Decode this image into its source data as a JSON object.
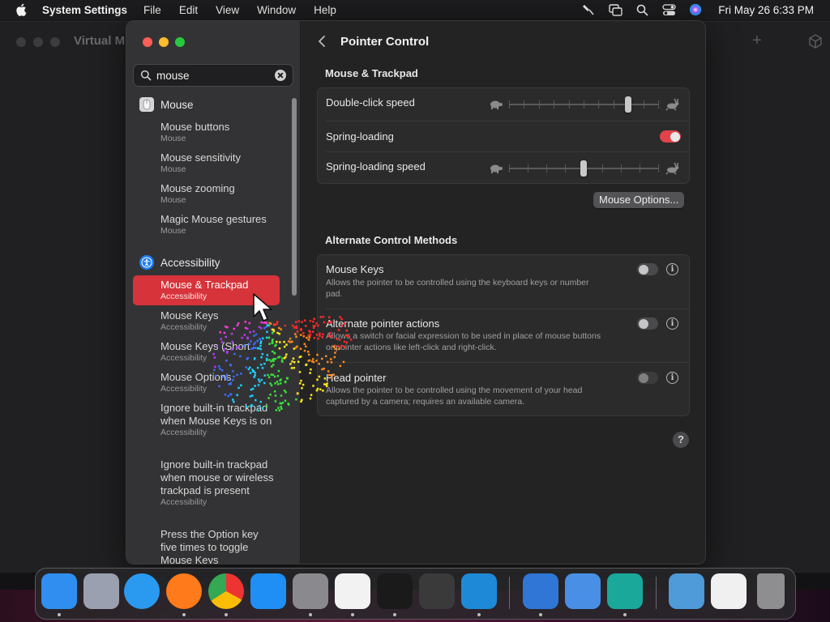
{
  "menubar": {
    "app_name": "System Settings",
    "menus": [
      "File",
      "Edit",
      "View",
      "Window",
      "Help"
    ],
    "clock": "Fri May 26  6:33 PM"
  },
  "background_window": {
    "title": "Virtual M"
  },
  "sidebar": {
    "search": {
      "value": "mouse"
    },
    "categories": [
      {
        "label": "Mouse",
        "icon": "mouse-icon"
      },
      {
        "label": "Accessibility",
        "icon": "accessibility-icon",
        "color": "#1e7cf2"
      }
    ],
    "results": [
      {
        "title": "Mouse buttons",
        "subtitle": "Mouse"
      },
      {
        "title": "Mouse sensitivity",
        "subtitle": "Mouse"
      },
      {
        "title": "Mouse zooming",
        "subtitle": "Mouse"
      },
      {
        "title": "Magic Mouse gestures",
        "subtitle": "Mouse"
      },
      {
        "title": "Mouse & Trackpad",
        "subtitle": "Accessibility",
        "selected": true
      },
      {
        "title": "Mouse Keys",
        "subtitle": "Accessibility"
      },
      {
        "title": "Mouse Keys (Short",
        "subtitle": "Accessibility"
      },
      {
        "title": "Mouse Options",
        "subtitle": "Accessibility"
      },
      {
        "title": "Ignore built-in trackpad when Mouse Keys is on",
        "subtitle": "Accessibility"
      },
      {
        "title": "Ignore built-in trackpad when mouse or wireless trackpad is present",
        "subtitle": "Accessibility"
      },
      {
        "title": "Press the Option key five times to toggle Mouse Keys",
        "subtitle": ""
      }
    ]
  },
  "main": {
    "title": "Pointer Control",
    "mouse_trackpad": {
      "heading": "Mouse & Trackpad",
      "double_click_speed": {
        "label": "Double-click speed",
        "value": 0.8
      },
      "spring_loading": {
        "label": "Spring-loading",
        "on": true
      },
      "spring_loading_speed": {
        "label": "Spring-loading speed",
        "value": 0.5
      },
      "mouse_options_button": "Mouse Options..."
    },
    "alternate": {
      "heading": "Alternate Control Methods",
      "items": [
        {
          "label": "Mouse Keys",
          "description": "Allows the pointer to be controlled using the keyboard keys or number pad.",
          "on": false
        },
        {
          "label": "Alternate pointer actions",
          "description": "Allows a switch or facial expression to be used in place of mouse buttons or pointer actions like left-click and right-click.",
          "on": false
        },
        {
          "label": "Head pointer",
          "description": "Allows the pointer to be controlled using the movement of your head captured by a camera; requires an available camera.",
          "on": false,
          "disabled": true
        }
      ]
    },
    "help": "?"
  },
  "dock": {
    "apps": [
      {
        "name": "finder-icon",
        "color": "#2f8ef0"
      },
      {
        "name": "launchpad-icon",
        "color": "#9aa0b0"
      },
      {
        "name": "safari-icon",
        "color": "#2a9af0"
      },
      {
        "name": "firefox-icon",
        "color": "#ff7a1a"
      },
      {
        "name": "chrome-icon",
        "color": "#e8e8e8"
      },
      {
        "name": "app-store-icon",
        "color": "#1f8ff5"
      },
      {
        "name": "system-settings-icon",
        "color": "#8a8a8e"
      },
      {
        "name": "textedit-icon",
        "color": "#f2f2f2"
      },
      {
        "name": "terminal-icon",
        "color": "#1a1a1a"
      },
      {
        "name": "garageband-icon",
        "color": "#3a3a3a"
      },
      {
        "name": "vscode-icon",
        "color": "#1e89d6"
      },
      {
        "name": "remote-desktop-icon",
        "color": "#2f76d6"
      },
      {
        "name": "weather-icon",
        "color": "#4a8fe6"
      },
      {
        "name": "screen-sharing-icon",
        "color": "#1aa89a"
      },
      {
        "name": "downloads-folder-icon",
        "color": "#4f9ad8"
      },
      {
        "name": "screenshot-thumbnail-icon",
        "color": "#f0f0f0"
      },
      {
        "name": "trash-icon",
        "color": "#8e8e90"
      }
    ]
  }
}
